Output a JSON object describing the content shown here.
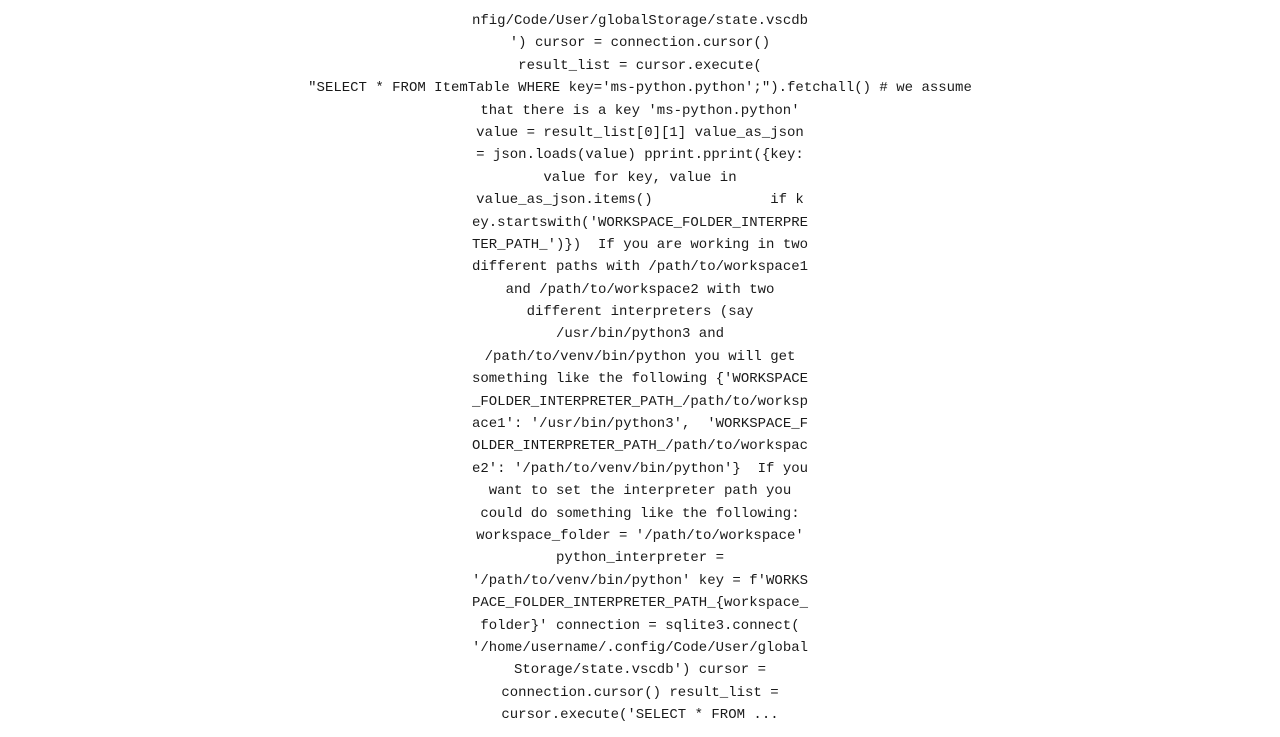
{
  "content": {
    "lines": [
      "nfig/Code/User/globalStorage/state.vscdb",
      "') cursor = connection.cursor()",
      "result_list = cursor.execute(",
      "\"SELECT * FROM ItemTable WHERE key='ms-python.python';\").fetchall() # we assume",
      "that there is a key 'ms-python.python'",
      "value = result_list[0][1] value_as_json",
      "= json.loads(value) pprint.pprint({key:",
      "value for key, value in",
      "value_as_json.items()              if k",
      "ey.startswith('WORKSPACE_FOLDER_INTERPRE",
      "TER_PATH_')})  If you are working in two",
      "different paths with /path/to/workspace1",
      "and /path/to/workspace2 with two",
      "different interpreters (say",
      "/usr/bin/python3 and",
      "/path/to/venv/bin/python you will get",
      "something like the following {'WORKSPACE",
      "_FOLDER_INTERPRETER_PATH_/path/to/worksp",
      "ace1': '/usr/bin/python3',  'WORKSPACE_F",
      "OLDER_INTERPRETER_PATH_/path/to/workspac",
      "e2': '/path/to/venv/bin/python'}  If you",
      "want to set the interpreter path you",
      "could do something like the following:",
      "workspace_folder = '/path/to/workspace'",
      "python_interpreter =",
      "'/path/to/venv/bin/python' key = f'WORKS",
      "PACE_FOLDER_INTERPRETER_PATH_{workspace_",
      "folder}' connection = sqlite3.connect(",
      "'/home/username/.config/Code/User/global",
      "Storage/state.vscdb') cursor =",
      "connection.cursor() result_list =",
      "cursor.execute('SELECT * FROM ..."
    ]
  }
}
